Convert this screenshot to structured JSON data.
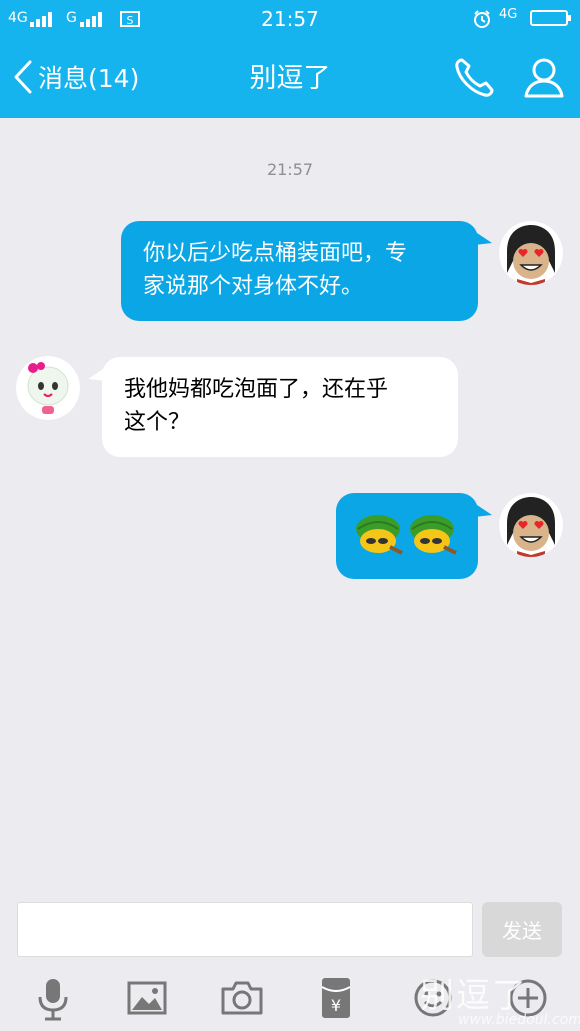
{
  "status_bar": {
    "network1": "4G",
    "network2": "G",
    "time": "21:57",
    "network3": "4G"
  },
  "header": {
    "back_label": "消息(14)",
    "title": "别逗了"
  },
  "chat": {
    "timestamp": "21:57",
    "messages": [
      {
        "direction": "outgoing",
        "lines": [
          "你以后少吃点桶装面吧，专",
          "家说那个对身体不好。"
        ]
      },
      {
        "direction": "incoming",
        "lines": [
          "我他妈都吃泡面了，还在乎",
          "这个？"
        ]
      },
      {
        "direction": "outgoing",
        "emoji": [
          "turtle-emoji",
          "turtle-emoji"
        ]
      }
    ]
  },
  "input": {
    "value": "",
    "send_label": "发送"
  },
  "toolbar": {
    "icons": [
      "microphone-icon",
      "image-icon",
      "camera-icon",
      "red-packet-icon",
      "emoji-icon",
      "plus-icon"
    ]
  },
  "watermark": {
    "text": "别逗了",
    "url": "www.biedoul.com"
  },
  "colors": {
    "brand_blue": "#16b4ee",
    "outgoing_bubble": "#0ba6e6",
    "chat_background": "#ebebf0",
    "send_disabled": "#d8d8d8"
  }
}
